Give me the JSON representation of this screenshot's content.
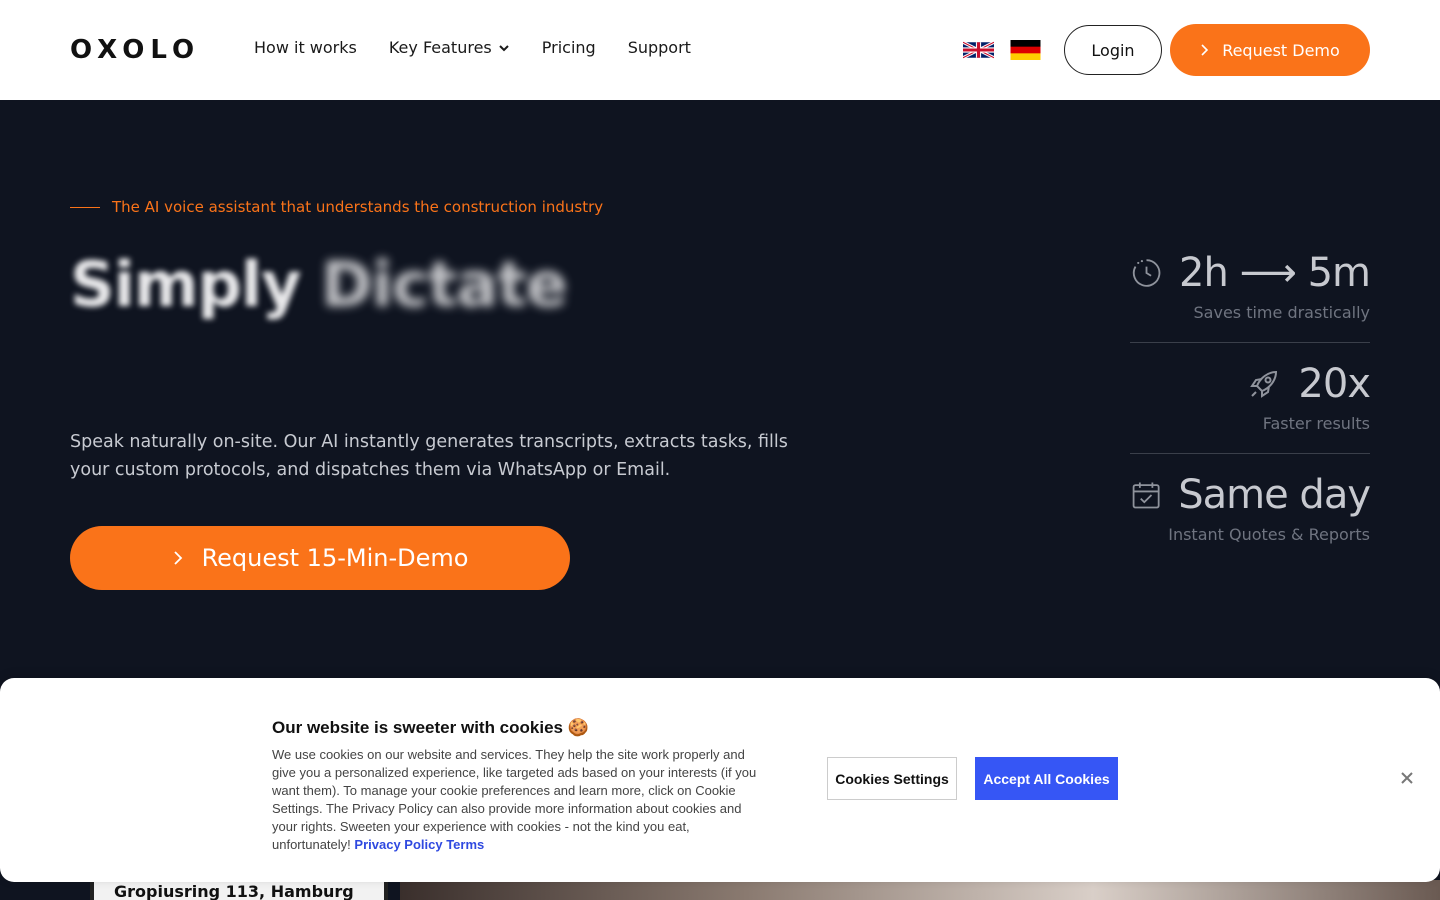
{
  "header": {
    "logo": "OXOLO",
    "nav": [
      {
        "label": "How it works"
      },
      {
        "label": "Key Features",
        "has_dropdown": true
      },
      {
        "label": "Pricing"
      },
      {
        "label": "Support"
      }
    ],
    "languages": [
      "English (UK flag)",
      "German (DE flag)"
    ],
    "login_label": "Login",
    "demo_label": "Request Demo"
  },
  "hero": {
    "eyebrow": "The AI voice assistant that understands the construction industry",
    "headline_word1": "Simply",
    "headline_word2": "Dictate",
    "description": "Speak naturally on-site. Our AI instantly generates transcripts, extracts tasks, fills your custom protocols, and dispatches them via WhatsApp or Email.",
    "cta_label": "Request 15-Min-Demo",
    "stats": [
      {
        "icon": "clock-icon",
        "value": "2h ⟶ 5m",
        "label": "Saves time drastically"
      },
      {
        "icon": "rocket-icon",
        "value": "20x",
        "label": "Faster results"
      },
      {
        "icon": "calendar-check-icon",
        "value": "Same day",
        "label": "Instant Quotes & Reports"
      }
    ]
  },
  "peek": {
    "card_text": "Gropiusring 113, Hamburg"
  },
  "cookie_banner": {
    "title": "Our website is sweeter with cookies 🍪",
    "body": "We use cookies on our website and services. They help the site work properly and give you a personalized experience, like targeted ads based on your interests (if you want them). To manage your cookie preferences and learn more, click on Cookie Settings. The Privacy Policy can also provide more information about cookies and your rights. Sweeten your experience with cookies - not the kind you eat, unfortunately!",
    "privacy_link": "Privacy Policy",
    "terms_link": "Terms",
    "settings_label": "Cookies Settings",
    "accept_label": "Accept All Cookies",
    "close_icon": "close-icon"
  },
  "colors": {
    "accent": "#fa7319",
    "hero_bg": "#0f1420",
    "cookie_accept": "#3656f5",
    "link": "#2f49e0"
  }
}
